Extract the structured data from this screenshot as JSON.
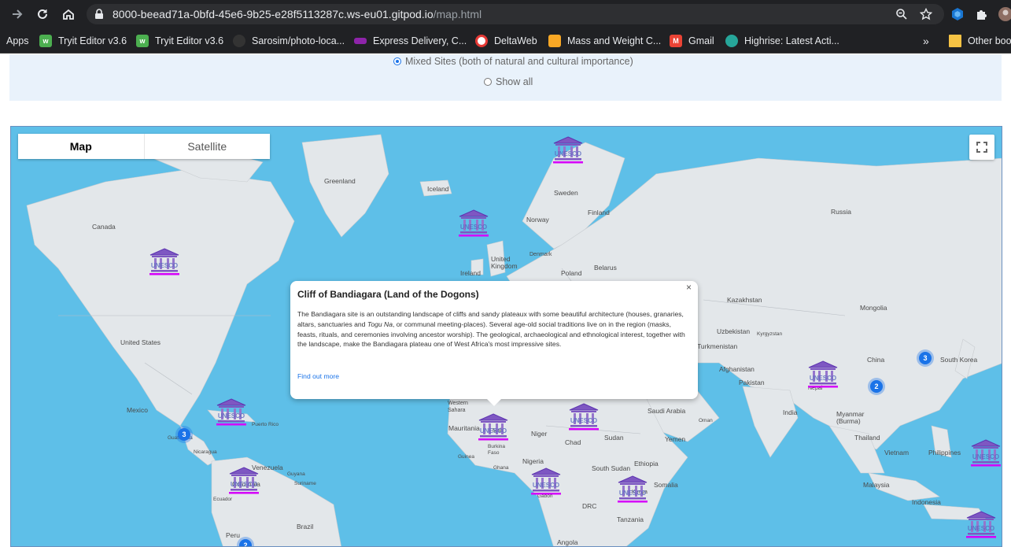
{
  "browser": {
    "url_main": "8000-beead71a-0bfd-45e6-9b25-e28f5113287c.ws-eu01.gitpod.io",
    "url_path": "/map.html"
  },
  "bookmarks": [
    {
      "label": "Apps",
      "icon": "apps-grid-icon",
      "color": "#8ab4f8"
    },
    {
      "label": "Tryit Editor v3.6",
      "icon": "w3schools-icon",
      "color": "#4caf50"
    },
    {
      "label": "Tryit Editor v3.6",
      "icon": "w3schools-icon",
      "color": "#4caf50"
    },
    {
      "label": "Sarosim/photo-loca...",
      "icon": "github-icon",
      "color": "#333333"
    },
    {
      "label": "Express Delivery, C...",
      "icon": "express-icon",
      "color": "#8e24aa"
    },
    {
      "label": "DeltaWeb",
      "icon": "deltaweb-icon",
      "color": "#e53935"
    },
    {
      "label": "Mass and Weight C...",
      "icon": "mass-weight-icon",
      "color": "#f9a825"
    },
    {
      "label": "Gmail",
      "icon": "gmail-icon",
      "color": "#ea4335"
    },
    {
      "label": "Highrise: Latest Acti...",
      "icon": "highrise-icon",
      "color": "#26a69a"
    },
    {
      "label": "»",
      "icon": "",
      "color": ""
    },
    {
      "label": "Other bookmarks",
      "icon": "folder-icon",
      "color": "#f6c344"
    }
  ],
  "filters": {
    "mixed_label": "Mixed Sites (both of natural and cultural importance)",
    "show_all_label": "Show all"
  },
  "map": {
    "map_type_map": "Map",
    "map_type_satellite": "Satellite",
    "labels": {
      "greenland": "Greenland",
      "iceland": "Iceland",
      "sweden": "Sweden",
      "finland": "Finland",
      "norway": "Norway",
      "russia": "Russia",
      "canada": "Canada",
      "united_kingdom": "United Kingdom",
      "denmark": "Denmark",
      "ireland": "Ireland",
      "poland": "Poland",
      "belarus": "Belarus",
      "germany": "Germany",
      "kazakhstan": "Kazakhstan",
      "mongolia": "Mongolia",
      "united_states": "United States",
      "uzbekistan": "Uzbekistan",
      "kyrgyzstan": "Kyrgyzstan",
      "turkmenistan": "Turkmenistan",
      "china": "China",
      "south_korea": "South Korea",
      "afghanistan": "Afghanistan",
      "iran": "Iran",
      "pakistan": "Pakistan",
      "nepal": "Nepal",
      "mexico": "Mexico",
      "puerto_rico": "Puerto Rico",
      "western_sahara": "Western Sahara",
      "mauritania": "Mauritania",
      "mali": "Mali",
      "niger": "Niger",
      "chad": "Chad",
      "sudan": "Sudan",
      "saudi_arabia": "Saudi Arabia",
      "oman": "Oman",
      "yemen": "Yemen",
      "india": "India",
      "myanmar": "Myanmar (Burma)",
      "thailand": "Thailand",
      "vietnam": "Vietnam",
      "philippines": "Philippines",
      "guatemala": "Guatemala",
      "nicaragua": "Nicaragua",
      "venezuela": "Venezuela",
      "guyana": "Guyana",
      "suriname": "Suriname",
      "colombia": "Colombia",
      "ecuador": "Ecuador",
      "guinea": "Guinea",
      "burkina_faso": "Burkina Faso",
      "ghana": "Ghana",
      "nigeria": "Nigeria",
      "south_sudan": "South Sudan",
      "ethiopia": "Ethiopia",
      "somalia": "Somalia",
      "kenya": "Kenya",
      "gabon": "Gabon",
      "drc": "DRC",
      "tanzania": "Tanzania",
      "malaysia": "Malaysia",
      "indonesia": "Indonesia",
      "brazil": "Brazil",
      "peru": "Peru",
      "angola": "Angola"
    },
    "marker_text": "UNESCO",
    "clusters": [
      "3",
      "2",
      "3",
      "2"
    ]
  },
  "infowindow": {
    "title": "Cliff of Bandiagara (Land of the Dogons)",
    "body_1": "The Bandiagara site is an outstanding landscape of cliffs and sandy plateaux with some beautiful architecture (houses, granaries, altars, sanctuaries and ",
    "body_italic": "Togu Na",
    "body_2": ", or communal meeting-places). Several age-old social traditions live on in the region (masks, feasts, rituals, and ceremonies involving ancestor worship). The geological, archaeological and ethnological interest, together with the landscape, make the Bandiagara plateau one of West Africa's most impressive sites.",
    "link": "Find out more",
    "close": "×"
  }
}
